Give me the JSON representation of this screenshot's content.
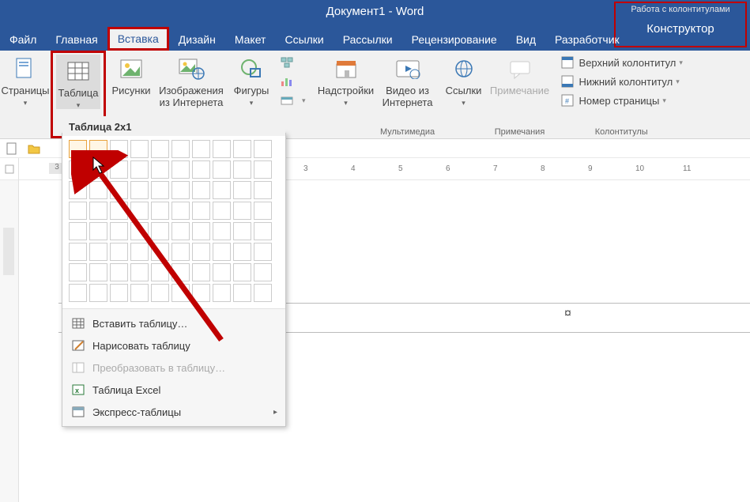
{
  "title": "Документ1 - Word",
  "context_tool": {
    "label": "Работа с колонтитулами",
    "tab": "Конструктор"
  },
  "tabs": {
    "file": "Файл",
    "home": "Главная",
    "insert": "Вставка",
    "design": "Дизайн",
    "layout": "Макет",
    "references": "Ссылки",
    "mailings": "Рассылки",
    "review": "Рецензирование",
    "view": "Вид",
    "developer": "Разработчик"
  },
  "ribbon": {
    "pages": "Страницы",
    "table": "Таблица",
    "pictures": "Рисунки",
    "online_pictures": "Изображения из Интернета",
    "shapes": "Фигуры",
    "addins": "Надстройки",
    "online_video": "Видео из Интернета",
    "links": "Ссылки",
    "comment": "Примечание",
    "header": "Верхний колонтитул",
    "footer": "Нижний колонтитул",
    "page_number": "Номер страницы",
    "grp_multimedia": "Мультимедиа",
    "grp_comments": "Примечания",
    "grp_hf": "Колонтитулы"
  },
  "table_dd": {
    "title": "Таблица 2x1",
    "insert_table": "Вставить таблицу…",
    "draw_table": "Нарисовать таблицу",
    "convert": "Преобразовать в таблицу…",
    "excel": "Таблица Excel",
    "quick": "Экспресс-таблицы"
  },
  "ruler": {
    "left_label": "3",
    "ticks": [
      "3",
      "4",
      "5",
      "6",
      "7",
      "8",
      "9",
      "10",
      "11"
    ]
  }
}
